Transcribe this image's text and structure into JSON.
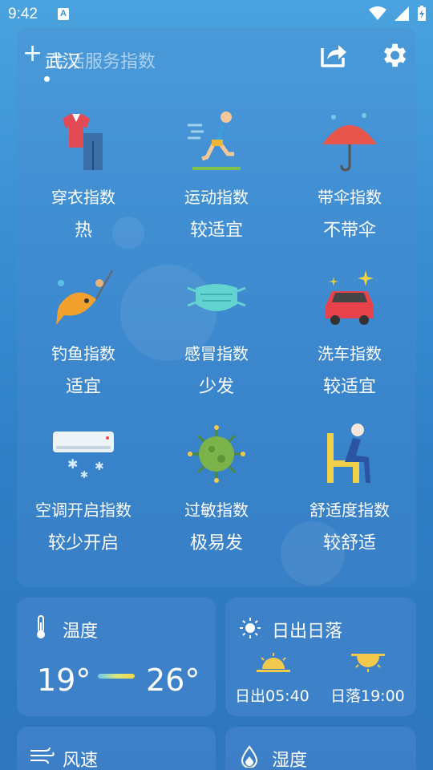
{
  "status_bar": {
    "time": "9:42"
  },
  "header": {
    "add": "+",
    "city": "武汉",
    "subtitle": "生活服务指数"
  },
  "indices": [
    {
      "label": "穿衣指数",
      "value": "热",
      "icon": "clothing-icon"
    },
    {
      "label": "运动指数",
      "value": "较适宜",
      "icon": "running-icon"
    },
    {
      "label": "带伞指数",
      "value": "不带伞",
      "icon": "umbrella-icon"
    },
    {
      "label": "钓鱼指数",
      "value": "适宜",
      "icon": "fishing-icon"
    },
    {
      "label": "感冒指数",
      "value": "少发",
      "icon": "mask-icon"
    },
    {
      "label": "洗车指数",
      "value": "较适宜",
      "icon": "car-wash-icon"
    },
    {
      "label": "空调开启指数",
      "value": "较少开启",
      "icon": "air-conditioner-icon"
    },
    {
      "label": "过敏指数",
      "value": "极易发",
      "icon": "virus-icon"
    },
    {
      "label": "舒适度指数",
      "value": "较舒适",
      "icon": "comfort-chair-icon"
    }
  ],
  "temperature": {
    "title": "温度",
    "low": "19°",
    "high": "26°"
  },
  "sun": {
    "title": "日出日落",
    "sunrise": "日出05:40",
    "sunset": "日落19:00"
  },
  "wind": {
    "title": "风速"
  },
  "humidity": {
    "title": "湿度"
  },
  "colors": {
    "accent": "#3a8fd3",
    "card": "#5a9ad6"
  }
}
